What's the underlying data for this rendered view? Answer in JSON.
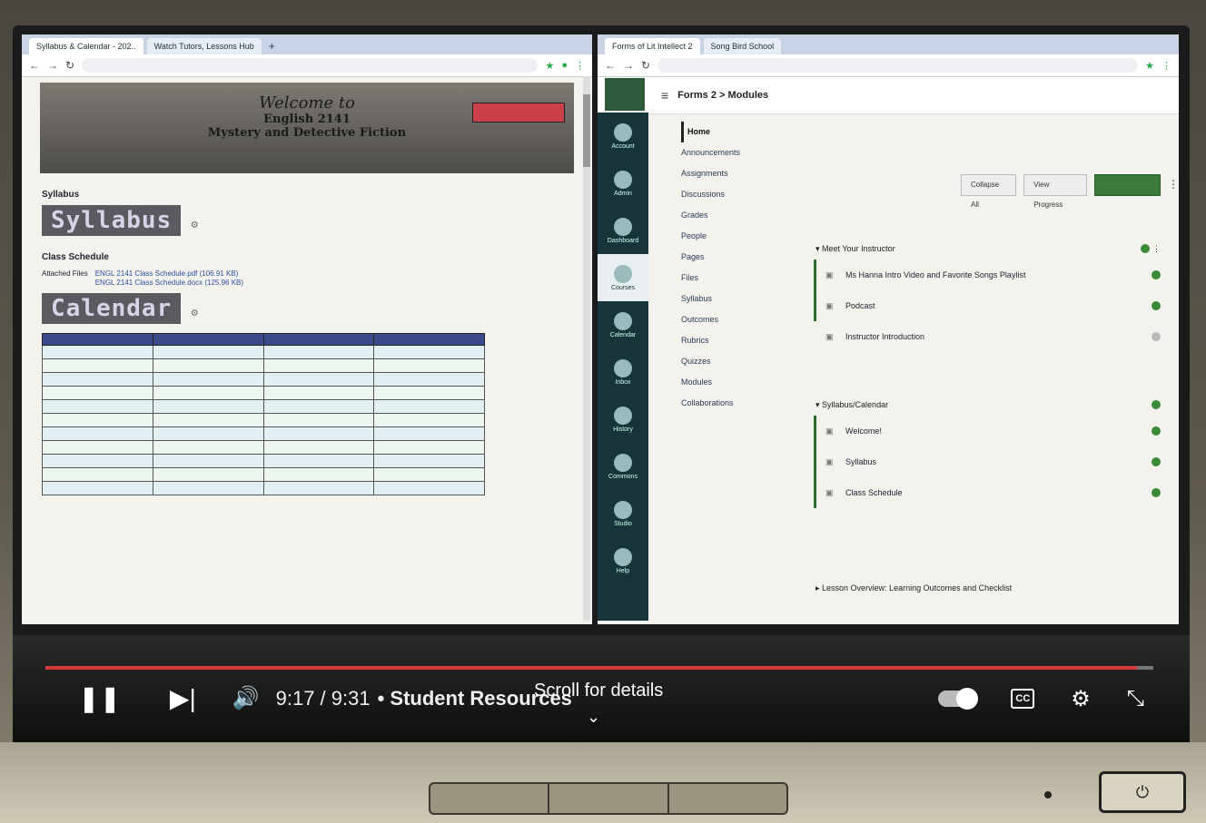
{
  "left_window": {
    "tabs": [
      "Syllabus & Calendar - 202..",
      "Watch Tutors, Lessons Hub"
    ],
    "tab_add": "+",
    "banner": {
      "welcome": "Welcome to",
      "course": "English 2141",
      "subtitle": "Mystery and Detective Fiction"
    },
    "syllabus_label": "Syllabus",
    "syllabus_stamp": "Syllabus",
    "class_schedule_label": "Class Schedule",
    "attached_files_label": "Attached Files",
    "attached_files": [
      "ENGL 2141 Class Schedule.pdf (106.91 KB)",
      "ENGL 2141 Class Schedule.docx (125.96 KB)"
    ],
    "calendar_stamp": "Calendar"
  },
  "right_window": {
    "tabs": [
      "Forms of Lit Intellect 2",
      "Song Bird School"
    ],
    "breadcrumb_menu": "≡",
    "breadcrumb": "Forms 2 > Modules",
    "global_nav": [
      "Account",
      "Admin",
      "Dashboard",
      "Courses",
      "Calendar",
      "Inbox",
      "History",
      "Commons",
      "Studio",
      "Help"
    ],
    "course_nav": [
      "Home",
      "Announcements",
      "Assignments",
      "Discussions",
      "Grades",
      "People",
      "Pages",
      "Files",
      "Syllabus",
      "Outcomes",
      "Rubrics",
      "Quizzes",
      "Modules",
      "Collaborations"
    ],
    "toolbar": {
      "collapse_all": "Collapse All",
      "view_progress": "View Progress"
    },
    "modules": [
      {
        "title": "Meet Your Instructor",
        "items": [
          "Ms Hanna Intro Video and Favorite Songs Playlist",
          "Podcast",
          "Instructor Introduction"
        ]
      },
      {
        "title": "Syllabus/Calendar",
        "items": [
          "Welcome!",
          "Syllabus",
          "Class Schedule"
        ]
      },
      {
        "title": "Lesson Overview: Learning Outcomes and Checklist",
        "items": []
      }
    ]
  },
  "player": {
    "progress_fraction": 0.985,
    "time": "9:17 / 9:31",
    "chapter": "• Student Resources",
    "scroll_hint": "Scroll for details",
    "cc_label": "CC",
    "icons": [
      "pause-icon",
      "next-icon",
      "volume-icon",
      "autoplay-toggle",
      "captions-icon",
      "settings-icon",
      "exit-fullscreen-icon"
    ]
  },
  "colors": {
    "progress": "#d23b3b",
    "canvas_nav": "#16343a",
    "publish_green": "#3a8a3a"
  }
}
